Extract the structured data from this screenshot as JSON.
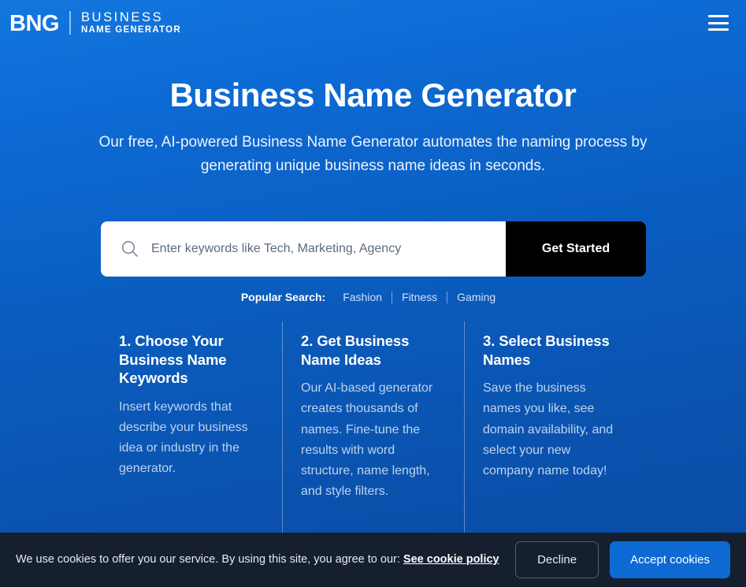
{
  "header": {
    "logo": {
      "mark": "BNG",
      "line1": "BUSINESS",
      "line2": "NAME GENERATOR"
    },
    "menu_icon": "hamburger-menu-icon"
  },
  "hero": {
    "title": "Business Name Generator",
    "subtitle": "Our free, AI-powered Business Name Generator automates the naming process by generating unique business name ideas in seconds."
  },
  "search": {
    "icon": "search-icon",
    "placeholder": "Enter keywords like Tech, Marketing, Agency",
    "value": "",
    "button_label": "Get Started"
  },
  "popular": {
    "label": "Popular Search:",
    "items": [
      "Fashion",
      "Fitness",
      "Gaming"
    ]
  },
  "steps": [
    {
      "title": "1. Choose Your Business Name Keywords",
      "body": "Insert keywords that describe your business idea or industry in the generator."
    },
    {
      "title": "2. Get Business Name Ideas",
      "body": "Our AI-based generator creates thousands of names. Fine-tune the results with word structure, name length, and style filters."
    },
    {
      "title": "3. Select Business Names",
      "body": "Save the business names you like, see domain availability, and select your new company name today!"
    }
  ],
  "cookie_banner": {
    "text": "We use cookies to offer you our service. By using this site, you agree to our:",
    "link_label": "See cookie policy",
    "decline_label": "Decline",
    "accept_label": "Accept cookies"
  },
  "colors": {
    "brand_blue": "#0d6ad4",
    "gradient_top": "#1277de",
    "gradient_bottom": "#084ba3",
    "banner_bg": "#151f2e",
    "button_black": "#000000",
    "body_text": "#bed4ee"
  }
}
